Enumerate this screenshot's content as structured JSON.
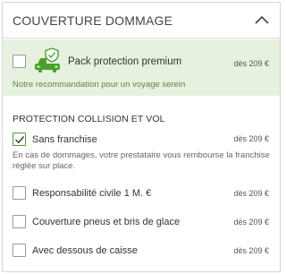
{
  "header": {
    "title": "COUVERTURE DOMMAGE",
    "toggle_icon": "chevron-up-icon"
  },
  "recommendation": {
    "label": "Pack protection premium",
    "price": "dès 209 €",
    "subtitle": "Notre recommandation pour un voyage serein",
    "icon": "car-shield-icon",
    "checked": false
  },
  "section": {
    "title": "PROTECTION COLLISION ET VOL"
  },
  "options": [
    {
      "label": "Sans franchise",
      "price": "dès 209 €",
      "checked": true,
      "description": "En cas de dommages, votre prestataire vous rembourse la franchise réglée sur place."
    },
    {
      "label": "Responsabilité civile 1 M. €",
      "price": "dès 209 €",
      "checked": false
    },
    {
      "label": "Couverture pneus et bris de glace",
      "price": "dès 209 €",
      "checked": false
    },
    {
      "label": "Avec dessous de caisse",
      "price": "dès 209 €",
      "checked": false
    }
  ],
  "colors": {
    "accent_green": "#4aa02c",
    "recommend_bg": "#e7f1df",
    "border": "#d6d6d6"
  }
}
